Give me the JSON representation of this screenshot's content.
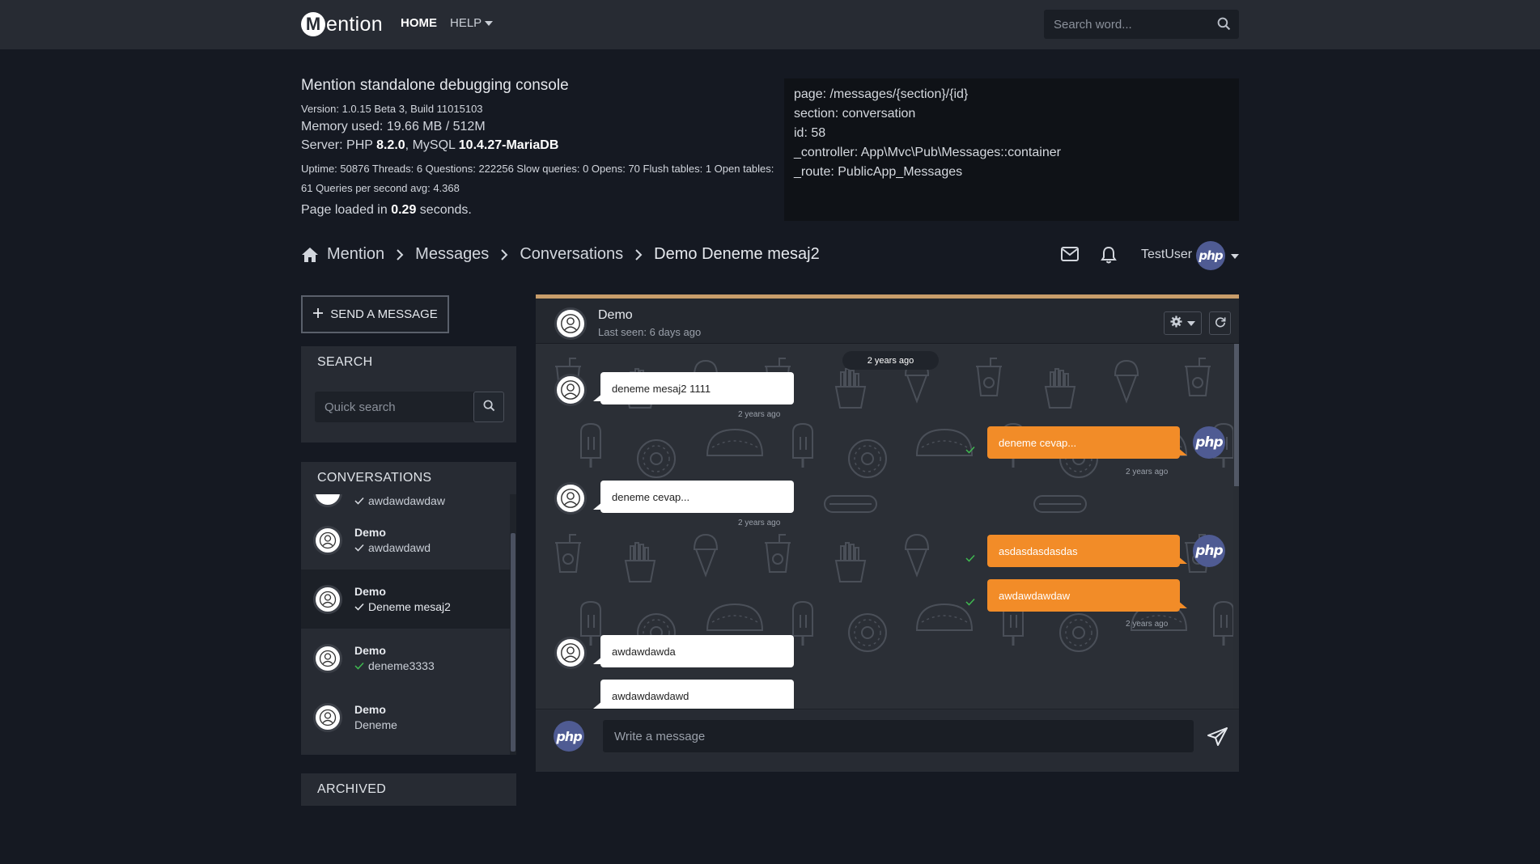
{
  "topbar": {
    "logo_letter": "M",
    "logo_text": "ention",
    "home_label": "HOME",
    "help_label": "HELP",
    "search_placeholder": "Search word..."
  },
  "debug": {
    "title": "Mention standalone debugging console",
    "version": "Version: 1.0.15 Beta 3, Build 11015103",
    "memory": "Memory used: 19.66 MB / 512M",
    "server_prefix": "Server: PHP ",
    "php_version": "8.2.0",
    "server_mid": ", MySQL ",
    "mysql_version": "10.4.27-MariaDB",
    "stats": "Uptime: 50876 Threads: 6 Questions: 222256 Slow queries: 0 Opens: 70 Flush tables: 1 Open tables: 61 Queries per second avg: 4.368",
    "load_prefix": "Page loaded in ",
    "load_time": "0.29",
    "load_suffix": " seconds.",
    "route_lines": [
      "page: /messages/{section}/{id}",
      "section: conversation",
      "id: 58",
      "_controller: App\\Mvc\\Pub\\Messages::container",
      "_route: PublicApp_Messages"
    ]
  },
  "breadcrumb": [
    "Mention",
    "Messages",
    "Conversations",
    "Demo Deneme mesaj2"
  ],
  "user": {
    "name": "TestUser",
    "avatar_text": "php"
  },
  "sidebar": {
    "send_label": "SEND A MESSAGE",
    "search_title": "SEARCH",
    "quick_search_placeholder": "Quick search",
    "conversations_title": "CONVERSATIONS",
    "partial_item_msg": "awdawdawdaw",
    "conversations": [
      {
        "name": "Demo",
        "msg": "awdawdawd",
        "tick": "white"
      },
      {
        "name": "Demo",
        "msg": "Deneme mesaj2",
        "tick": "white"
      },
      {
        "name": "Demo",
        "msg": "deneme3333",
        "tick": "green"
      },
      {
        "name": "Demo",
        "msg": "Deneme",
        "tick": "none"
      }
    ],
    "archived_title": "ARCHIVED"
  },
  "chat": {
    "name": "Demo",
    "last_seen": "Last seen: 6 days ago",
    "date_pill": "2 years ago",
    "compose_placeholder": "Write a message",
    "messages": [
      {
        "dir": "in",
        "text": "deneme mesaj2 1111",
        "time": "2 years ago"
      },
      {
        "dir": "out",
        "text": "deneme cevap...",
        "time": "2 years ago"
      },
      {
        "dir": "in",
        "text": "deneme cevap...",
        "time": "2 years ago"
      },
      {
        "dir": "out",
        "text": "asdasdasdasdas",
        "time": ""
      },
      {
        "dir": "out",
        "text": "awdawdawdaw",
        "time": "2 years ago"
      },
      {
        "dir": "in",
        "text": "awdawdawda",
        "time": ""
      },
      {
        "dir": "in",
        "text": "awdawdawdawd",
        "time": ""
      }
    ]
  },
  "colors": {
    "accent_orange": "#f28c28",
    "tick_green": "#3fb950",
    "php_badge": "#4f5b93"
  },
  "icons": [
    "search-icon",
    "home-icon",
    "chevron-right-icon",
    "envelope-icon",
    "bell-icon",
    "plus-icon",
    "user-icon",
    "check-icon",
    "gear-icon",
    "refresh-icon",
    "paper-plane-icon"
  ]
}
